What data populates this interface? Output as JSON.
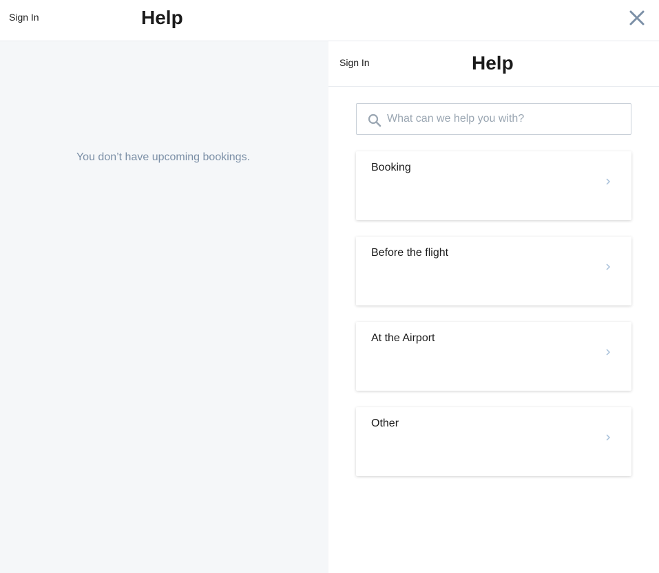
{
  "topbar": {
    "signin_label": "Sign In",
    "title": "Help",
    "close_icon": "close-icon"
  },
  "left": {
    "empty_message": "You don’t have upcoming bookings."
  },
  "panel": {
    "signin_label": "Sign In",
    "title": "Help",
    "search": {
      "placeholder": "What can we help you with?",
      "value": ""
    },
    "categories": [
      {
        "label": "Booking"
      },
      {
        "label": "Before the flight"
      },
      {
        "label": "At the Airport"
      },
      {
        "label": "Other"
      }
    ]
  },
  "colors": {
    "icon_gray": "#7b8fa6",
    "chevron_blue": "#a8c0da",
    "left_bg": "#f5f7f9"
  }
}
